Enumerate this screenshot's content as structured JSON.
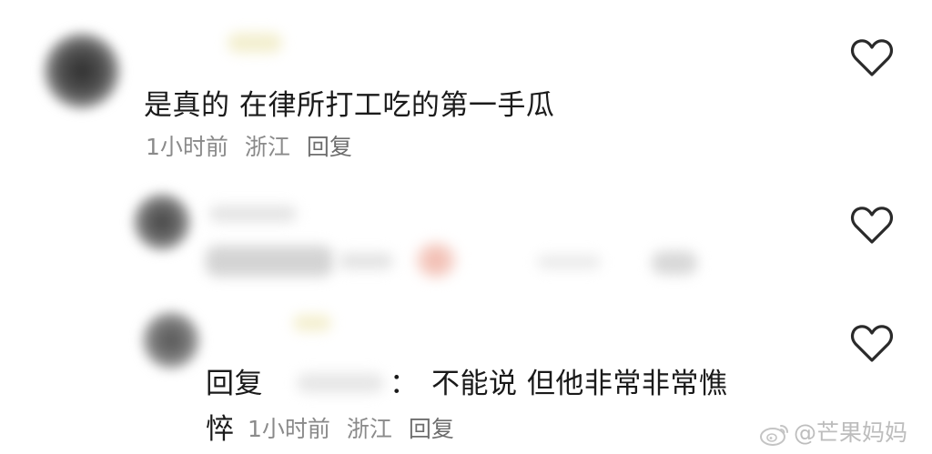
{
  "comments": [
    {
      "text": "是真的 在律所打工吃的第一手瓜",
      "time": "1小时前",
      "location": "浙江",
      "reply_label": "回复"
    },
    {
      "text": "",
      "time": "",
      "location": "",
      "reply_label": ""
    },
    {
      "reply_prefix": "回复",
      "colon": "：",
      "text_line1": "不能说 但他非常非常憔",
      "text_line2": "悴",
      "time": "1小时前",
      "location": "浙江",
      "reply_label": "回复"
    }
  ],
  "icons": {
    "like": "heart-outline-icon",
    "watermark": "weibo-logo-icon"
  },
  "watermark": {
    "text": "@芒果妈妈"
  },
  "colors": {
    "text": "#1a1a1a",
    "meta": "#8a8a8a",
    "heart_stroke": "#2a2a2a",
    "watermark": "#bdbdbd"
  }
}
